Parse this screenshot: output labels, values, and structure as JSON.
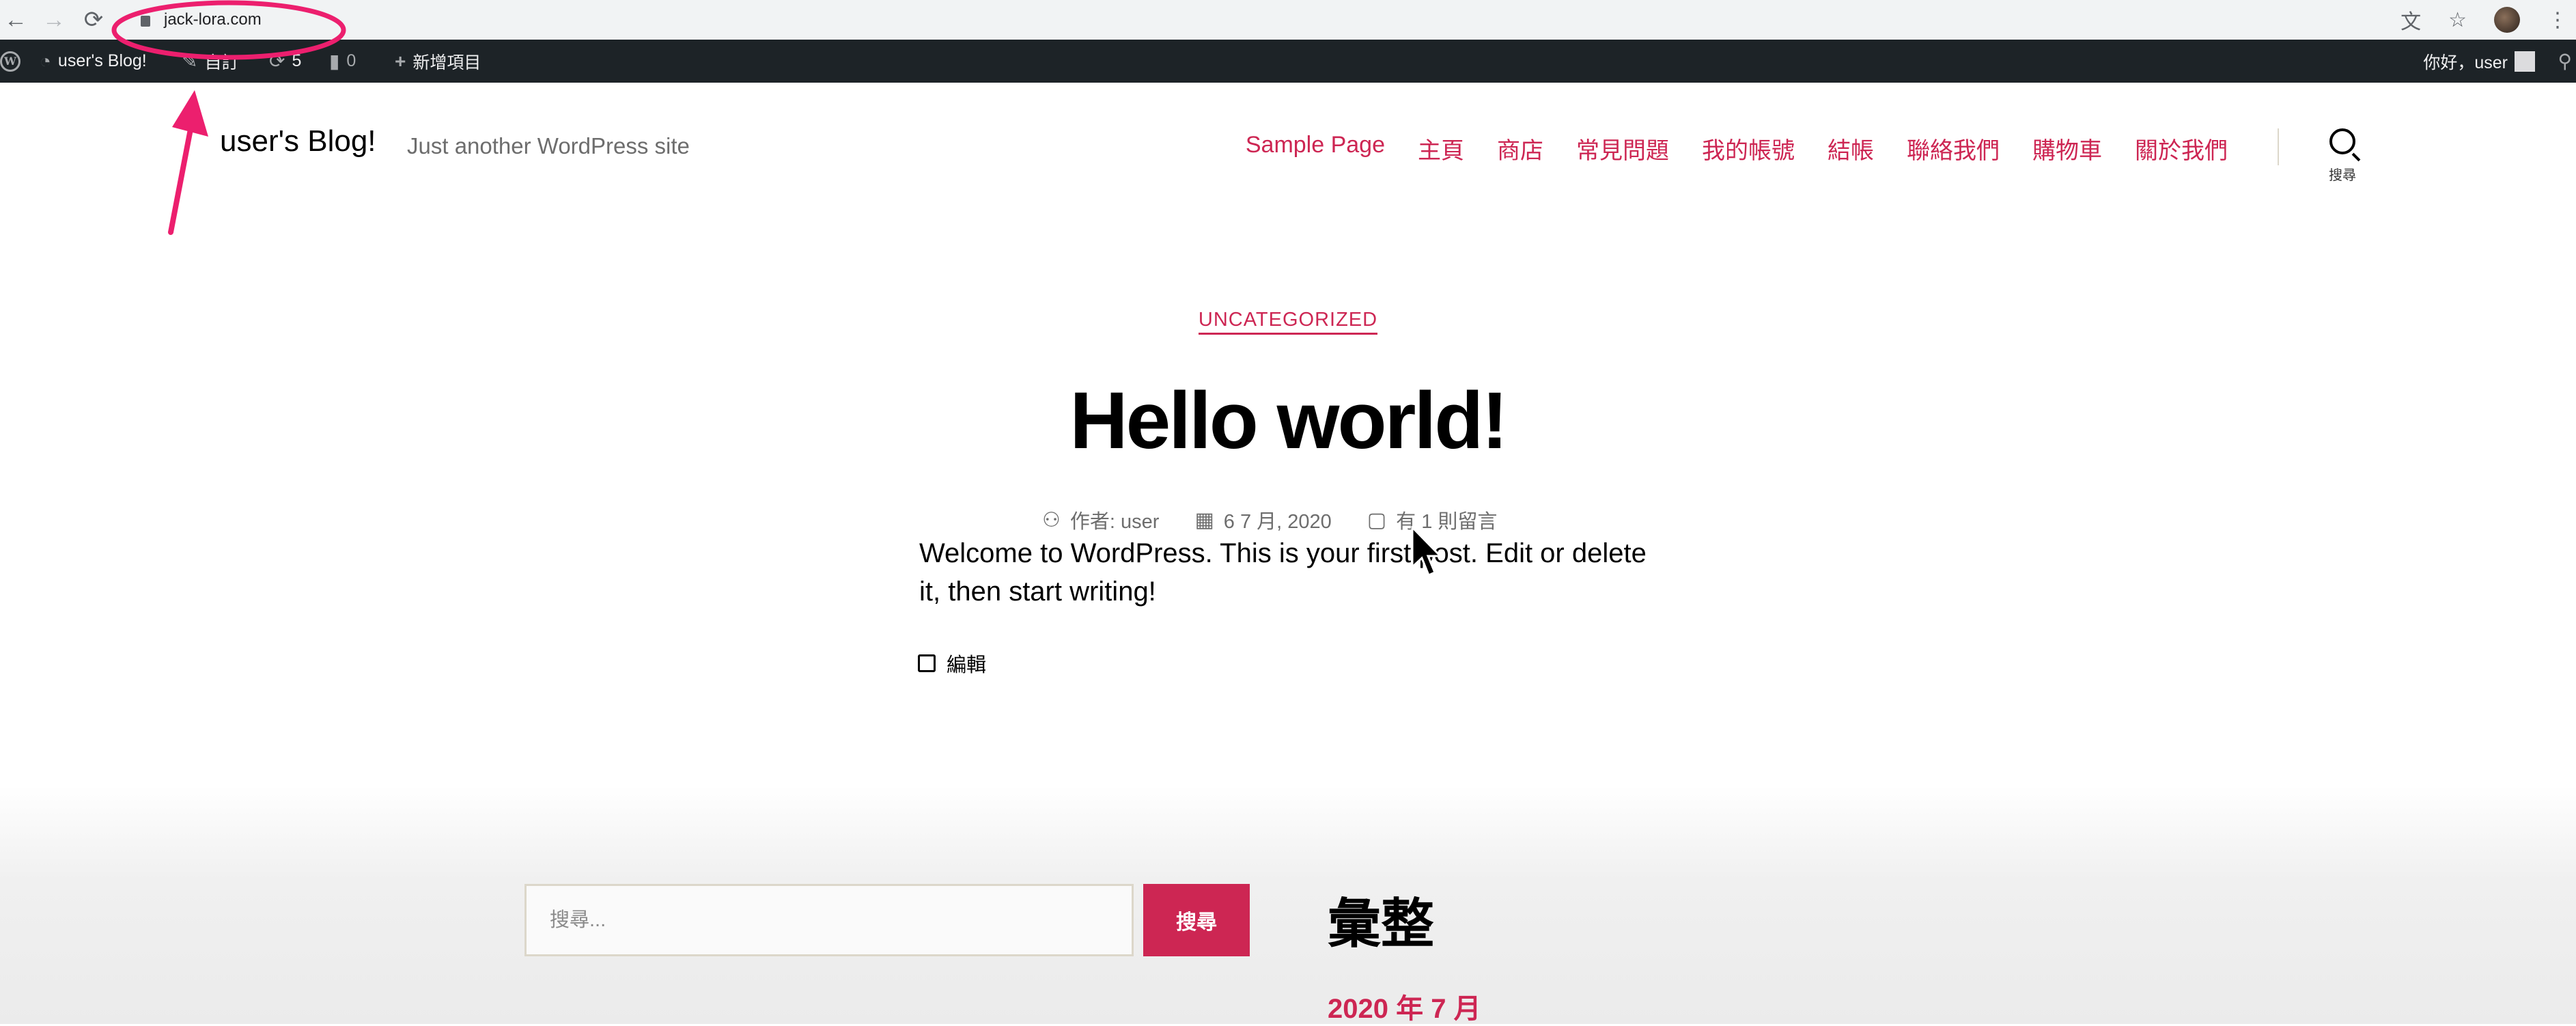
{
  "browser": {
    "url": "jack-lora.com",
    "back_icon": "←",
    "forward_icon": "→",
    "reload_icon": "⟳",
    "translate_icon": "文",
    "star_icon": "☆",
    "menu_icon": "⋮"
  },
  "adminbar": {
    "site_name": "user's Blog!",
    "customize_label": "自訂",
    "updates_count": "5",
    "comments_count": "0",
    "new_label": "新增項目",
    "greeting": "你好，user"
  },
  "site": {
    "title": "user's Blog!",
    "description": "Just another WordPress site",
    "nav": [
      "Sample Page",
      "主頁",
      "商店",
      "常見問題",
      "我的帳號",
      "結帳",
      "聯絡我們",
      "購物車",
      "關於我們"
    ],
    "search_label": "搜尋"
  },
  "post": {
    "category": "UNCATEGORIZED",
    "title": "Hello world!",
    "author": "作者: user",
    "date": "6 7 月, 2020",
    "comments": "有 1 則留言",
    "content": "Welcome to WordPress. This is your first post. Edit or delete it, then start writing!",
    "edit_label": "編輯"
  },
  "widgets": {
    "search_placeholder": "搜尋...",
    "search_button": "搜尋",
    "archives_title": "彙整",
    "archive_item": "2020 年 7 月"
  },
  "colors": {
    "accent": "#cd2653",
    "annotation": "#ec1f6e",
    "adminbar_bg": "#1d2327"
  }
}
